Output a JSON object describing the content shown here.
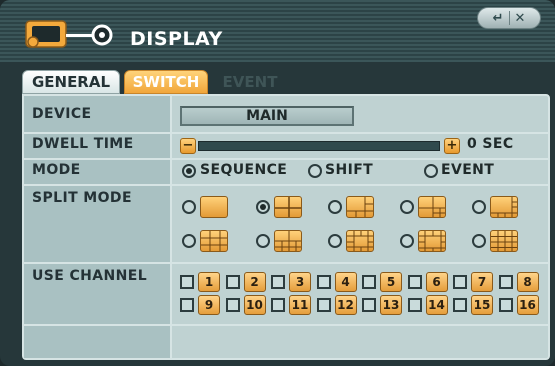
{
  "header": {
    "title": "DISPLAY",
    "close_label": "✕",
    "back_label": "↵"
  },
  "tabs": [
    {
      "label": "GENERAL",
      "state": "normal"
    },
    {
      "label": "SWITCH",
      "state": "active"
    },
    {
      "label": "EVENT",
      "state": "disabled"
    }
  ],
  "rows": {
    "device": {
      "label": "DEVICE",
      "value": "MAIN"
    },
    "dwell": {
      "label": "DWELL TIME",
      "value": "0 SEC",
      "minus": "−",
      "plus": "+",
      "level": 0.0
    },
    "mode": {
      "label": "MODE",
      "options": [
        "SEQUENCE",
        "SHIFT",
        "EVENT"
      ],
      "selected": "SEQUENCE"
    },
    "split": {
      "label": "SPLIT MODE",
      "selected_index": 1
    },
    "use_channel": {
      "label": "USE CHANNEL",
      "channels": [
        "1",
        "2",
        "3",
        "4",
        "5",
        "6",
        "7",
        "8",
        "9",
        "10",
        "11",
        "12",
        "13",
        "14",
        "15",
        "16"
      ]
    }
  },
  "colors": {
    "accent_orange": "#f1a63a",
    "panel": "#bfd2d2",
    "label_col": "#a9c1c2",
    "header": "#3b5659"
  }
}
